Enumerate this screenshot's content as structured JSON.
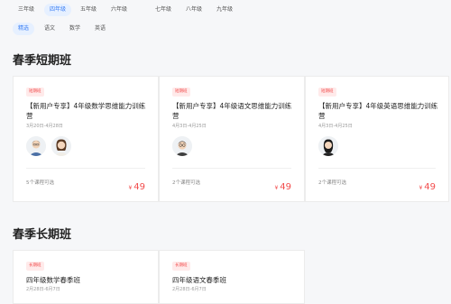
{
  "grades": [
    "三年级",
    "四年级",
    "五年级",
    "六年级",
    "七年级",
    "八年级",
    "九年级"
  ],
  "active_grade": "四年级",
  "subjects": [
    "精选",
    "语文",
    "数学",
    "英语"
  ],
  "active_subject": "精选",
  "spring_short": {
    "title": "春季短期班",
    "cards": [
      {
        "tag": "短期班",
        "title": "【新用户专享】4年级数学思维能力训练营",
        "date": "3月20日-4月28日",
        "count": "5个课程可选",
        "currency": "¥",
        "price": "49"
      },
      {
        "tag": "短期班",
        "title": "【新用户专享】4年级语文思维能力训练营",
        "date": "4月3日-4月25日",
        "count": "2个课程可选",
        "currency": "¥",
        "price": "49"
      },
      {
        "tag": "短期班",
        "title": "【新用户专享】4年级英语思维能力训练营",
        "date": "4月3日-4月25日",
        "count": "2个课程可选",
        "currency": "¥",
        "price": "49"
      }
    ]
  },
  "spring_long": {
    "title": "春季长期班",
    "cards": [
      {
        "tag": "长期班",
        "title": "四年级数学春季班",
        "date": "2月28日-6月7日"
      },
      {
        "tag": "长期班",
        "title": "四年级语文春季班",
        "date": "2月28日-6月7日"
      }
    ]
  },
  "colors": {
    "accent": "#3b7ff5",
    "price": "#f24b4b"
  }
}
